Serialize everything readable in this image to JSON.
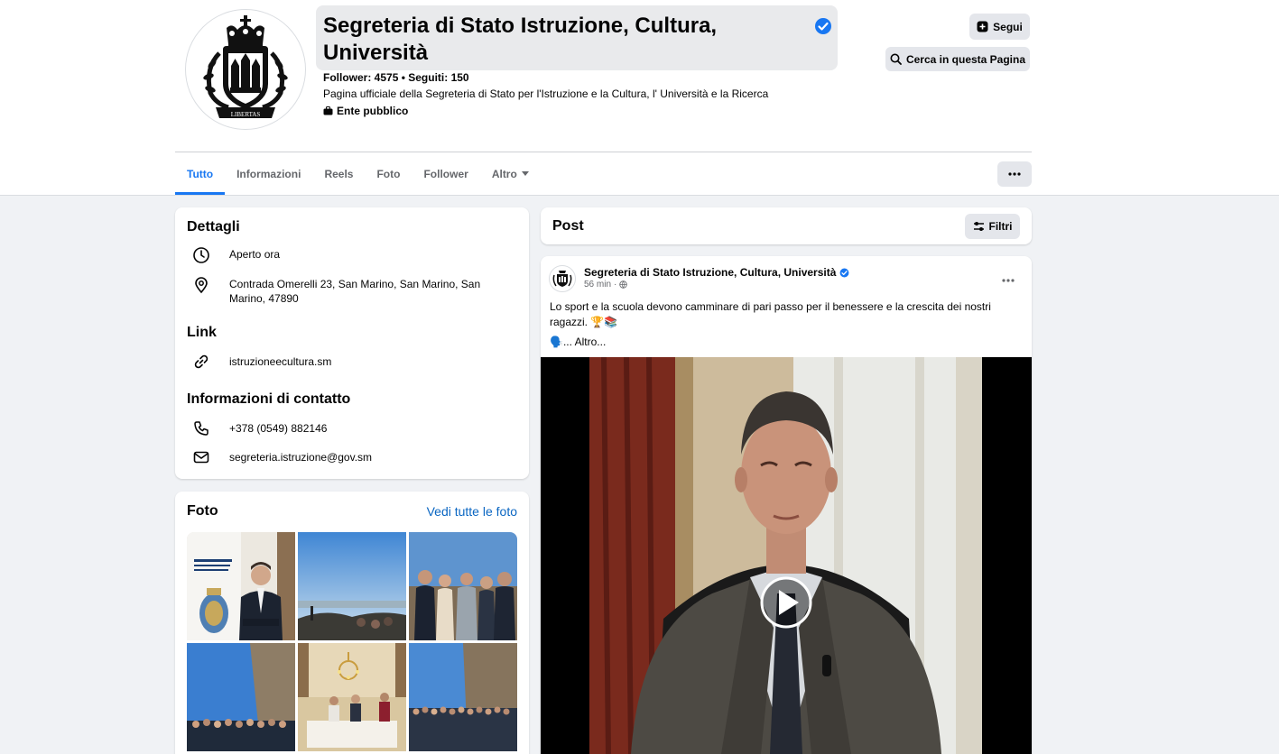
{
  "page": {
    "title": "Segreteria di Stato Istruzione, Cultura, Università",
    "stats": "Follower: 4575 • Seguiti: 150",
    "description": "Pagina ufficiale della Segreteria di Stato per l'Istruzione e la Cultura, l' Università e la Ricerca",
    "category": "Ente pubblico",
    "logo_text": "LIBERTAS"
  },
  "actions": {
    "follow": "Segui",
    "search": "Cerca in questa Pagina"
  },
  "tabs": [
    {
      "label": "Tutto"
    },
    {
      "label": "Informazioni"
    },
    {
      "label": "Reels"
    },
    {
      "label": "Foto"
    },
    {
      "label": "Follower"
    },
    {
      "label": "Altro"
    }
  ],
  "details": {
    "heading": "Dettagli",
    "open": "Aperto ora",
    "address": "Contrada Omerelli 23, San Marino, San Marino, San Marino, 47890",
    "link_heading": "Link",
    "website": "istruzioneecultura.sm",
    "contact_heading": "Informazioni di contatto",
    "phone": "+378 (0549) 882146",
    "email": "segreteria.istruzione@gov.sm"
  },
  "photos": {
    "heading": "Foto",
    "see_all": "Vedi tutte le foto"
  },
  "posts": {
    "heading": "Post",
    "filters": "Filtri"
  },
  "post": {
    "author": "Segreteria di Stato Istruzione, Cultura, Università",
    "time": "56 min",
    "separator": "·",
    "text": "Lo sport e la scuola devono camminare di pari passo per il benessere e la crescita dei nostri ragazzi. 🏆📚",
    "more": "🗣️... Altro..."
  },
  "colors": {
    "accent": "#1877f2",
    "link": "#0a66c2",
    "background": "#f0f2f5"
  }
}
